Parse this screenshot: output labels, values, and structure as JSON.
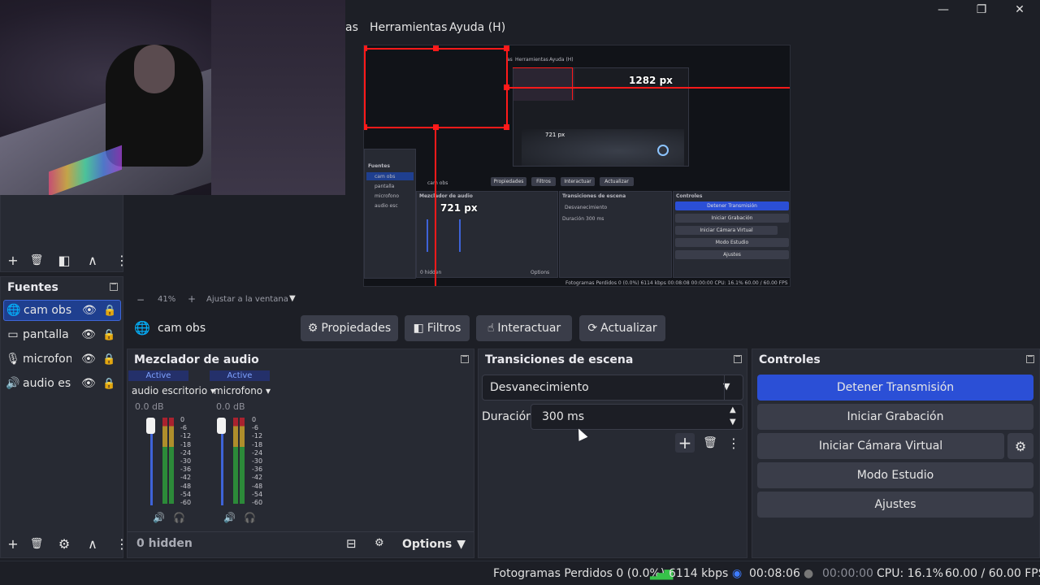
{
  "window": {
    "minimize": "—",
    "restore": "❐",
    "close": "✕"
  },
  "menu": {
    "items": [
      "as",
      "Herramientas",
      "Ayuda (H)"
    ]
  },
  "preview": {
    "mini_menu": [
      "as",
      "Herramientas",
      "Ayuda (H)"
    ],
    "width_label": "1282 px",
    "height_label": "721 px",
    "width_label_small": "721 px",
    "height_label_small": "721 px",
    "mini_fuentes": "Fuentes",
    "mini_sources": [
      "cam obs",
      "pantalla",
      "microfono",
      "audio esc"
    ],
    "mini_source_name": "cam obs",
    "mini_tools": [
      "Propiedades",
      "Filtros",
      "Interactuar",
      "Actualizar"
    ],
    "mini_mixer_title": "Mezclador de audio",
    "mini_trans_title": "Transiciones de escena",
    "mini_controls_title": "Controles",
    "mini_fade": "Desvanecimiento",
    "mini_duration_label": "Duración",
    "mini_duration": "300 ms",
    "mini_hidden": "0 hidden",
    "mini_options": "Options",
    "mini_controls": [
      "Detener Transmisión",
      "Iniciar Grabación",
      "Iniciar Cámara Virtual",
      "Modo Estudio",
      "Ajustes"
    ],
    "mini_status": "Fotogramas Perdidos 0 (0.0%)   6114 kbps   00:08:08   00:00:00   CPU: 16.1%   60.00 / 60.00 FPS"
  },
  "zoom_bar": {
    "minus": "−",
    "zoom": "41%",
    "plus": "+",
    "fit": "Ajustar a la ventana",
    "dropdown": "▼"
  },
  "scenes_toolbar": {
    "add": "+",
    "remove": "🗑",
    "filter": "◧",
    "up": "∧",
    "more": "⋮"
  },
  "sources": {
    "title": "Fuentes",
    "items": [
      {
        "label": "cam obs",
        "icon": "🌐"
      },
      {
        "label": "pantalla",
        "icon": "▭"
      },
      {
        "label": "microfono",
        "icon": "🎙"
      },
      {
        "label": "audio escritorio",
        "icon": "🔊"
      }
    ],
    "eye": "👁",
    "lock": "🔒",
    "toolbar": {
      "add": "+",
      "remove": "🗑",
      "settings": "⚙",
      "up": "∧",
      "more": "⋮"
    }
  },
  "source_bar": {
    "icon": "🌐",
    "name": "cam obs",
    "properties": "Propiedades",
    "filters": "Filtros",
    "interact": "Interactuar",
    "refresh": "Actualizar"
  },
  "mixer": {
    "title": "Mezclador de audio",
    "strips": [
      {
        "badge": "Active",
        "name": "audio escritorio",
        "db": "0.0 dB"
      },
      {
        "badge": "Active",
        "name": "microfono",
        "db": "0.0 dB"
      }
    ],
    "scale": [
      "0",
      "-6",
      "-12",
      "-18",
      "-24",
      "-30",
      "-36",
      "-42",
      "-48",
      "-54",
      "-60"
    ],
    "hidden": "0 hidden",
    "options": "Options"
  },
  "transitions": {
    "title": "Transiciones de escena",
    "selected": "Desvanecimiento",
    "duration_label": "Duración",
    "duration_value": "300 ms"
  },
  "controls": {
    "title": "Controles",
    "stop_stream": "Detener Transmisión",
    "start_recording": "Iniciar Grabación",
    "start_virtual_cam": "Iniciar Cámara Virtual",
    "studio_mode": "Modo Estudio",
    "settings": "Ajustes"
  },
  "status": {
    "dropped_frames": "Fotogramas Perdidos 0 (0.0%)",
    "bitrate": "6114 kbps",
    "stream_time": "00:08:06",
    "record_time": "00:00:00",
    "cpu": "CPU: 16.1%",
    "fps": "60.00 / 60.00 FPS"
  },
  "colors": {
    "accent": "#2b4fd6",
    "selection": "#1f3f8f",
    "bitrate_green": "#37c34a",
    "overlay_red": "#ff1a1a"
  }
}
